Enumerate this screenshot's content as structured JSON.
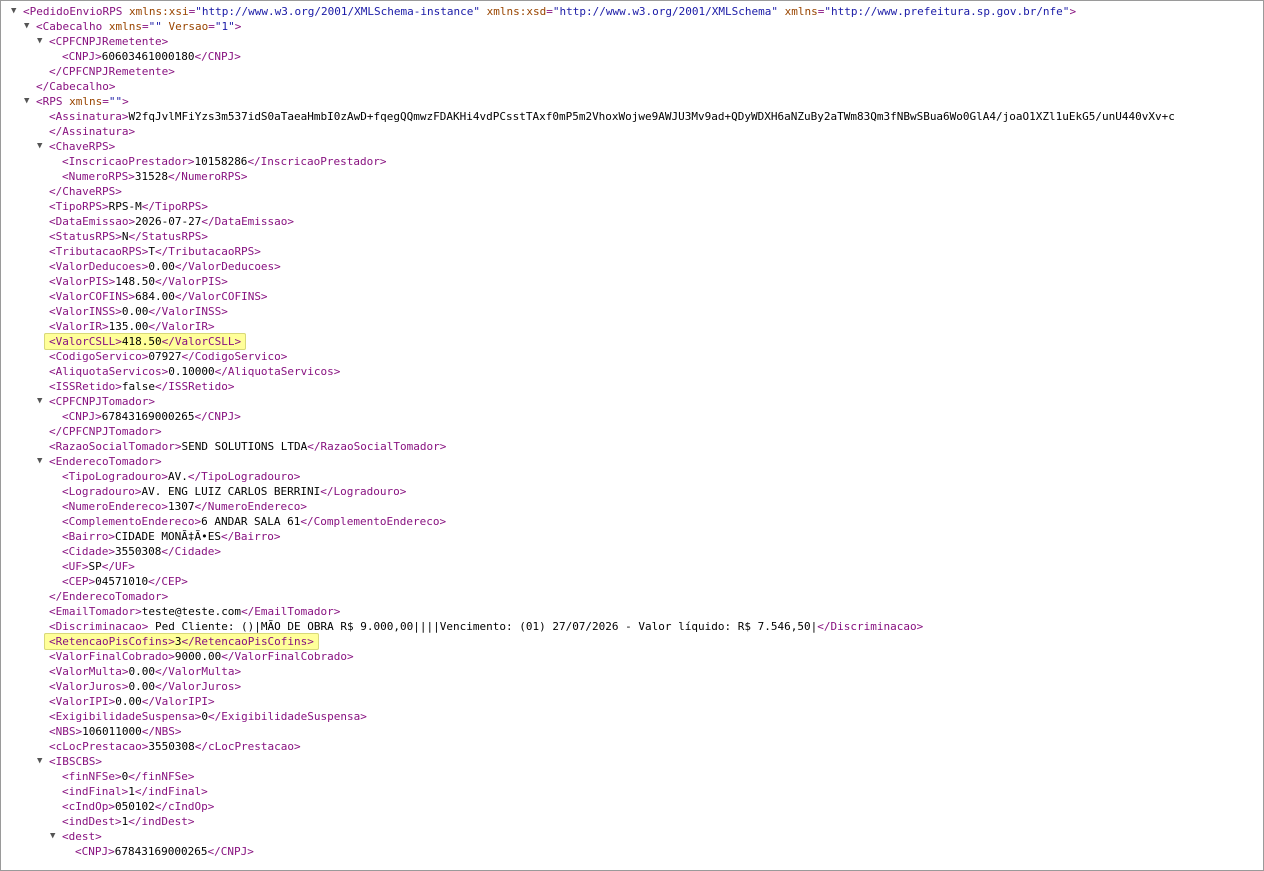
{
  "colors": {
    "tag": "#881280",
    "attr_name": "#994500",
    "attr_value": "#1a1aa6",
    "highlight": "#ffff99"
  },
  "icons": {
    "expanded": "triangle-down-icon"
  },
  "lines": [
    {
      "d": 0,
      "t": true,
      "p": [
        [
          "t",
          "<PedidoEnvioRPS "
        ],
        [
          "an",
          "xmlns:xsi"
        ],
        [
          "t",
          "="
        ],
        [
          "av",
          "\"http://www.w3.org/2001/XMLSchema-instance\""
        ],
        [
          "t",
          " "
        ],
        [
          "an",
          "xmlns:xsd"
        ],
        [
          "t",
          "="
        ],
        [
          "av",
          "\"http://www.w3.org/2001/XMLSchema\""
        ],
        [
          "t",
          " "
        ],
        [
          "an",
          "xmlns"
        ],
        [
          "t",
          "="
        ],
        [
          "av",
          "\"http://www.prefeitura.sp.gov.br/nfe\""
        ],
        [
          "t",
          ">"
        ]
      ]
    },
    {
      "d": 1,
      "t": true,
      "p": [
        [
          "t",
          "<Cabecalho "
        ],
        [
          "an",
          "xmlns"
        ],
        [
          "t",
          "="
        ],
        [
          "av",
          "\"\""
        ],
        [
          "t",
          " "
        ],
        [
          "an",
          "Versao"
        ],
        [
          "t",
          "="
        ],
        [
          "av",
          "\"1\""
        ],
        [
          "t",
          ">"
        ]
      ]
    },
    {
      "d": 2,
      "t": true,
      "p": [
        [
          "t",
          "<CPFCNPJRemetente>"
        ]
      ]
    },
    {
      "d": 3,
      "p": [
        [
          "t",
          "<CNPJ>"
        ],
        [
          "x",
          "60603461000180"
        ],
        [
          "t",
          "</CNPJ>"
        ]
      ]
    },
    {
      "d": 2,
      "p": [
        [
          "t",
          "</CPFCNPJRemetente>"
        ]
      ]
    },
    {
      "d": 1,
      "p": [
        [
          "t",
          "</Cabecalho>"
        ]
      ]
    },
    {
      "d": 1,
      "t": true,
      "p": [
        [
          "t",
          "<RPS "
        ],
        [
          "an",
          "xmlns"
        ],
        [
          "t",
          "="
        ],
        [
          "av",
          "\"\""
        ],
        [
          "t",
          ">"
        ]
      ]
    },
    {
      "d": 2,
      "p": [
        [
          "t",
          "<Assinatura>"
        ],
        [
          "x",
          "W2fqJvlMFiYzs3m537idS0aTaeaHmbI0zAwD+fqegQQmwzFDAKHi4vdPCsstTAxf0mP5m2VhoxWojwe9AWJU3Mv9ad+QDyWDXH6aNZuBy2aTWm83Qm3fNBwSBua6Wo0GlA4/joaO1XZl1uEkG5/unU440vXv+c"
        ]
      ]
    },
    {
      "d": 2,
      "p": [
        [
          "t",
          "</Assinatura>"
        ]
      ]
    },
    {
      "d": 2,
      "t": true,
      "p": [
        [
          "t",
          "<ChaveRPS>"
        ]
      ]
    },
    {
      "d": 3,
      "p": [
        [
          "t",
          "<InscricaoPrestador>"
        ],
        [
          "x",
          "10158286"
        ],
        [
          "t",
          "</InscricaoPrestador>"
        ]
      ]
    },
    {
      "d": 3,
      "p": [
        [
          "t",
          "<NumeroRPS>"
        ],
        [
          "x",
          "31528"
        ],
        [
          "t",
          "</NumeroRPS>"
        ]
      ]
    },
    {
      "d": 2,
      "p": [
        [
          "t",
          "</ChaveRPS>"
        ]
      ]
    },
    {
      "d": 2,
      "p": [
        [
          "t",
          "<TipoRPS>"
        ],
        [
          "x",
          "RPS-M"
        ],
        [
          "t",
          "</TipoRPS>"
        ]
      ]
    },
    {
      "d": 2,
      "p": [
        [
          "t",
          "<DataEmissao>"
        ],
        [
          "x",
          "2026-07-27"
        ],
        [
          "t",
          "</DataEmissao>"
        ]
      ]
    },
    {
      "d": 2,
      "p": [
        [
          "t",
          "<StatusRPS>"
        ],
        [
          "x",
          "N"
        ],
        [
          "t",
          "</StatusRPS>"
        ]
      ]
    },
    {
      "d": 2,
      "p": [
        [
          "t",
          "<TributacaoRPS>"
        ],
        [
          "x",
          "T"
        ],
        [
          "t",
          "</TributacaoRPS>"
        ]
      ]
    },
    {
      "d": 2,
      "p": [
        [
          "t",
          "<ValorDeducoes>"
        ],
        [
          "x",
          "0.00"
        ],
        [
          "t",
          "</ValorDeducoes>"
        ]
      ]
    },
    {
      "d": 2,
      "p": [
        [
          "t",
          "<ValorPIS>"
        ],
        [
          "x",
          "148.50"
        ],
        [
          "t",
          "</ValorPIS>"
        ]
      ]
    },
    {
      "d": 2,
      "p": [
        [
          "t",
          "<ValorCOFINS>"
        ],
        [
          "x",
          "684.00"
        ],
        [
          "t",
          "</ValorCOFINS>"
        ]
      ]
    },
    {
      "d": 2,
      "p": [
        [
          "t",
          "<ValorINSS>"
        ],
        [
          "x",
          "0.00"
        ],
        [
          "t",
          "</ValorINSS>"
        ]
      ]
    },
    {
      "d": 2,
      "p": [
        [
          "t",
          "<ValorIR>"
        ],
        [
          "x",
          "135.00"
        ],
        [
          "t",
          "</ValorIR>"
        ]
      ]
    },
    {
      "d": 2,
      "hl": true,
      "p": [
        [
          "t",
          "<ValorCSLL>"
        ],
        [
          "x",
          "418.50"
        ],
        [
          "t",
          "</ValorCSLL>"
        ]
      ]
    },
    {
      "d": 2,
      "p": [
        [
          "t",
          "<CodigoServico>"
        ],
        [
          "x",
          "07927"
        ],
        [
          "t",
          "</CodigoServico>"
        ]
      ]
    },
    {
      "d": 2,
      "p": [
        [
          "t",
          "<AliquotaServicos>"
        ],
        [
          "x",
          "0.10000"
        ],
        [
          "t",
          "</AliquotaServicos>"
        ]
      ]
    },
    {
      "d": 2,
      "p": [
        [
          "t",
          "<ISSRetido>"
        ],
        [
          "x",
          "false"
        ],
        [
          "t",
          "</ISSRetido>"
        ]
      ]
    },
    {
      "d": 2,
      "t": true,
      "p": [
        [
          "t",
          "<CPFCNPJTomador>"
        ]
      ]
    },
    {
      "d": 3,
      "p": [
        [
          "t",
          "<CNPJ>"
        ],
        [
          "x",
          "67843169000265"
        ],
        [
          "t",
          "</CNPJ>"
        ]
      ]
    },
    {
      "d": 2,
      "p": [
        [
          "t",
          "</CPFCNPJTomador>"
        ]
      ]
    },
    {
      "d": 2,
      "p": [
        [
          "t",
          "<RazaoSocialTomador>"
        ],
        [
          "x",
          "SEND SOLUTIONS LTDA"
        ],
        [
          "t",
          "</RazaoSocialTomador>"
        ]
      ]
    },
    {
      "d": 2,
      "t": true,
      "p": [
        [
          "t",
          "<EnderecoTomador>"
        ]
      ]
    },
    {
      "d": 3,
      "p": [
        [
          "t",
          "<TipoLogradouro>"
        ],
        [
          "x",
          "AV."
        ],
        [
          "t",
          "</TipoLogradouro>"
        ]
      ]
    },
    {
      "d": 3,
      "p": [
        [
          "t",
          "<Logradouro>"
        ],
        [
          "x",
          "AV. ENG LUIZ CARLOS BERRINI"
        ],
        [
          "t",
          "</Logradouro>"
        ]
      ]
    },
    {
      "d": 3,
      "p": [
        [
          "t",
          "<NumeroEndereco>"
        ],
        [
          "x",
          "1307"
        ],
        [
          "t",
          "</NumeroEndereco>"
        ]
      ]
    },
    {
      "d": 3,
      "p": [
        [
          "t",
          "<ComplementoEndereco>"
        ],
        [
          "x",
          "6 ANDAR SALA 61"
        ],
        [
          "t",
          "</ComplementoEndereco>"
        ]
      ]
    },
    {
      "d": 3,
      "p": [
        [
          "t",
          "<Bairro>"
        ],
        [
          "x",
          "CIDADE MONÃ‡Ã•ES"
        ],
        [
          "t",
          "</Bairro>"
        ]
      ]
    },
    {
      "d": 3,
      "p": [
        [
          "t",
          "<Cidade>"
        ],
        [
          "x",
          "3550308"
        ],
        [
          "t",
          "</Cidade>"
        ]
      ]
    },
    {
      "d": 3,
      "p": [
        [
          "t",
          "<UF>"
        ],
        [
          "x",
          "SP"
        ],
        [
          "t",
          "</UF>"
        ]
      ]
    },
    {
      "d": 3,
      "p": [
        [
          "t",
          "<CEP>"
        ],
        [
          "x",
          "04571010"
        ],
        [
          "t",
          "</CEP>"
        ]
      ]
    },
    {
      "d": 2,
      "p": [
        [
          "t",
          "</EnderecoTomador>"
        ]
      ]
    },
    {
      "d": 2,
      "p": [
        [
          "t",
          "<EmailTomador>"
        ],
        [
          "x",
          "teste@teste.com"
        ],
        [
          "t",
          "</EmailTomador>"
        ]
      ]
    },
    {
      "d": 2,
      "p": [
        [
          "t",
          "<Discriminacao>"
        ],
        [
          "x",
          " Ped Cliente: ()|MÃO DE OBRA R$ 9.000,00||||Vencimento: (01) 27/07/2026 - Valor líquido: R$ 7.546,50|"
        ],
        [
          "t",
          "</Discriminacao>"
        ]
      ]
    },
    {
      "d": 2,
      "hl": true,
      "p": [
        [
          "t",
          "<RetencaoPisCofins>"
        ],
        [
          "x",
          "3"
        ],
        [
          "t",
          "</RetencaoPisCofins>"
        ]
      ]
    },
    {
      "d": 2,
      "p": [
        [
          "t",
          "<ValorFinalCobrado>"
        ],
        [
          "x",
          "9000.00"
        ],
        [
          "t",
          "</ValorFinalCobrado>"
        ]
      ]
    },
    {
      "d": 2,
      "p": [
        [
          "t",
          "<ValorMulta>"
        ],
        [
          "x",
          "0.00"
        ],
        [
          "t",
          "</ValorMulta>"
        ]
      ]
    },
    {
      "d": 2,
      "p": [
        [
          "t",
          "<ValorJuros>"
        ],
        [
          "x",
          "0.00"
        ],
        [
          "t",
          "</ValorJuros>"
        ]
      ]
    },
    {
      "d": 2,
      "p": [
        [
          "t",
          "<ValorIPI>"
        ],
        [
          "x",
          "0.00"
        ],
        [
          "t",
          "</ValorIPI>"
        ]
      ]
    },
    {
      "d": 2,
      "p": [
        [
          "t",
          "<ExigibilidadeSuspensa>"
        ],
        [
          "x",
          "0"
        ],
        [
          "t",
          "</ExigibilidadeSuspensa>"
        ]
      ]
    },
    {
      "d": 2,
      "p": [
        [
          "t",
          "<NBS>"
        ],
        [
          "x",
          "106011000"
        ],
        [
          "t",
          "</NBS>"
        ]
      ]
    },
    {
      "d": 2,
      "p": [
        [
          "t",
          "<cLocPrestacao>"
        ],
        [
          "x",
          "3550308"
        ],
        [
          "t",
          "</cLocPrestacao>"
        ]
      ]
    },
    {
      "d": 2,
      "t": true,
      "p": [
        [
          "t",
          "<IBSCBS>"
        ]
      ]
    },
    {
      "d": 3,
      "p": [
        [
          "t",
          "<finNFSe>"
        ],
        [
          "x",
          "0"
        ],
        [
          "t",
          "</finNFSe>"
        ]
      ]
    },
    {
      "d": 3,
      "p": [
        [
          "t",
          "<indFinal>"
        ],
        [
          "x",
          "1"
        ],
        [
          "t",
          "</indFinal>"
        ]
      ]
    },
    {
      "d": 3,
      "p": [
        [
          "t",
          "<cIndOp>"
        ],
        [
          "x",
          "050102"
        ],
        [
          "t",
          "</cIndOp>"
        ]
      ]
    },
    {
      "d": 3,
      "p": [
        [
          "t",
          "<indDest>"
        ],
        [
          "x",
          "1"
        ],
        [
          "t",
          "</indDest>"
        ]
      ]
    },
    {
      "d": 3,
      "t": true,
      "p": [
        [
          "t",
          "<dest>"
        ]
      ]
    },
    {
      "d": 4,
      "p": [
        [
          "t",
          "<CNPJ>"
        ],
        [
          "x",
          "67843169000265"
        ],
        [
          "t",
          "</CNPJ>"
        ]
      ]
    }
  ]
}
